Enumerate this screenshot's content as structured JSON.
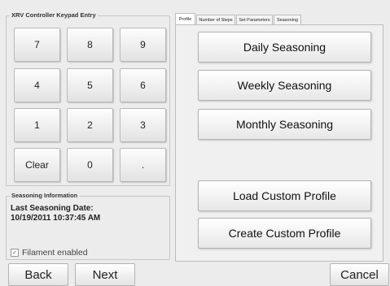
{
  "keypad": {
    "title": "XRV Controller Keypad Entry",
    "keys": [
      "7",
      "8",
      "9",
      "4",
      "5",
      "6",
      "1",
      "2",
      "3",
      "Clear",
      "0",
      "."
    ]
  },
  "seasoning_info": {
    "title": "Seasoning Information",
    "last_label": "Last Seasoning Date:",
    "last_value": "10/19/2011 10:37:45 AM",
    "filament_label": "Filament enabled",
    "filament_checked": true
  },
  "tabs": [
    {
      "label": "Profile",
      "active": true
    },
    {
      "label": "Number of Steps",
      "active": false
    },
    {
      "label": "Set Parameters",
      "active": false
    },
    {
      "label": "Seasoning",
      "active": false
    }
  ],
  "profile_buttons": {
    "daily": "Daily Seasoning",
    "weekly": "Weekly Seasoning",
    "monthly": "Monthly Seasoning",
    "load": "Load Custom Profile",
    "create": "Create Custom Profile"
  },
  "navigation": {
    "back": "Back",
    "next": "Next",
    "cancel": "Cancel"
  }
}
